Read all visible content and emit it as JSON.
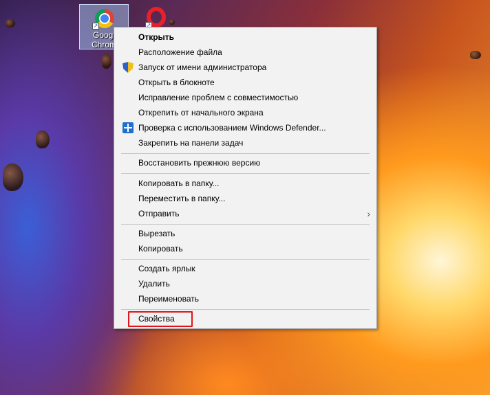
{
  "desktop": {
    "icons": [
      {
        "label": "Googl\nChrom",
        "name": "Google Chrome"
      },
      {
        "label": "",
        "name": "Opera"
      }
    ]
  },
  "context_menu": {
    "items": [
      {
        "label": "Открыть",
        "bold": true
      },
      {
        "label": "Расположение файла"
      },
      {
        "label": "Запуск от имени администратора",
        "icon": "uac-shield-icon"
      },
      {
        "label": "Открыть в блокноте"
      },
      {
        "label": "Исправление проблем с совместимостью"
      },
      {
        "label": "Открепить от начального экрана"
      },
      {
        "label": "Проверка с использованием Windows Defender...",
        "icon": "windows-defender-icon"
      },
      {
        "label": "Закрепить на панели задач"
      },
      {
        "label": "Восстановить прежнюю версию"
      },
      {
        "label": "Копировать в папку..."
      },
      {
        "label": "Переместить в папку..."
      },
      {
        "label": "Отправить",
        "submenu": true
      },
      {
        "label": "Вырезать"
      },
      {
        "label": "Копировать"
      },
      {
        "label": "Создать ярлык"
      },
      {
        "label": "Удалить"
      },
      {
        "label": "Переименовать"
      },
      {
        "label": "Свойства",
        "highlighted": true
      }
    ],
    "submenu_arrow": "›"
  },
  "colors": {
    "highlight_border": "#e0141b",
    "menu_background": "#f2f2f2"
  }
}
